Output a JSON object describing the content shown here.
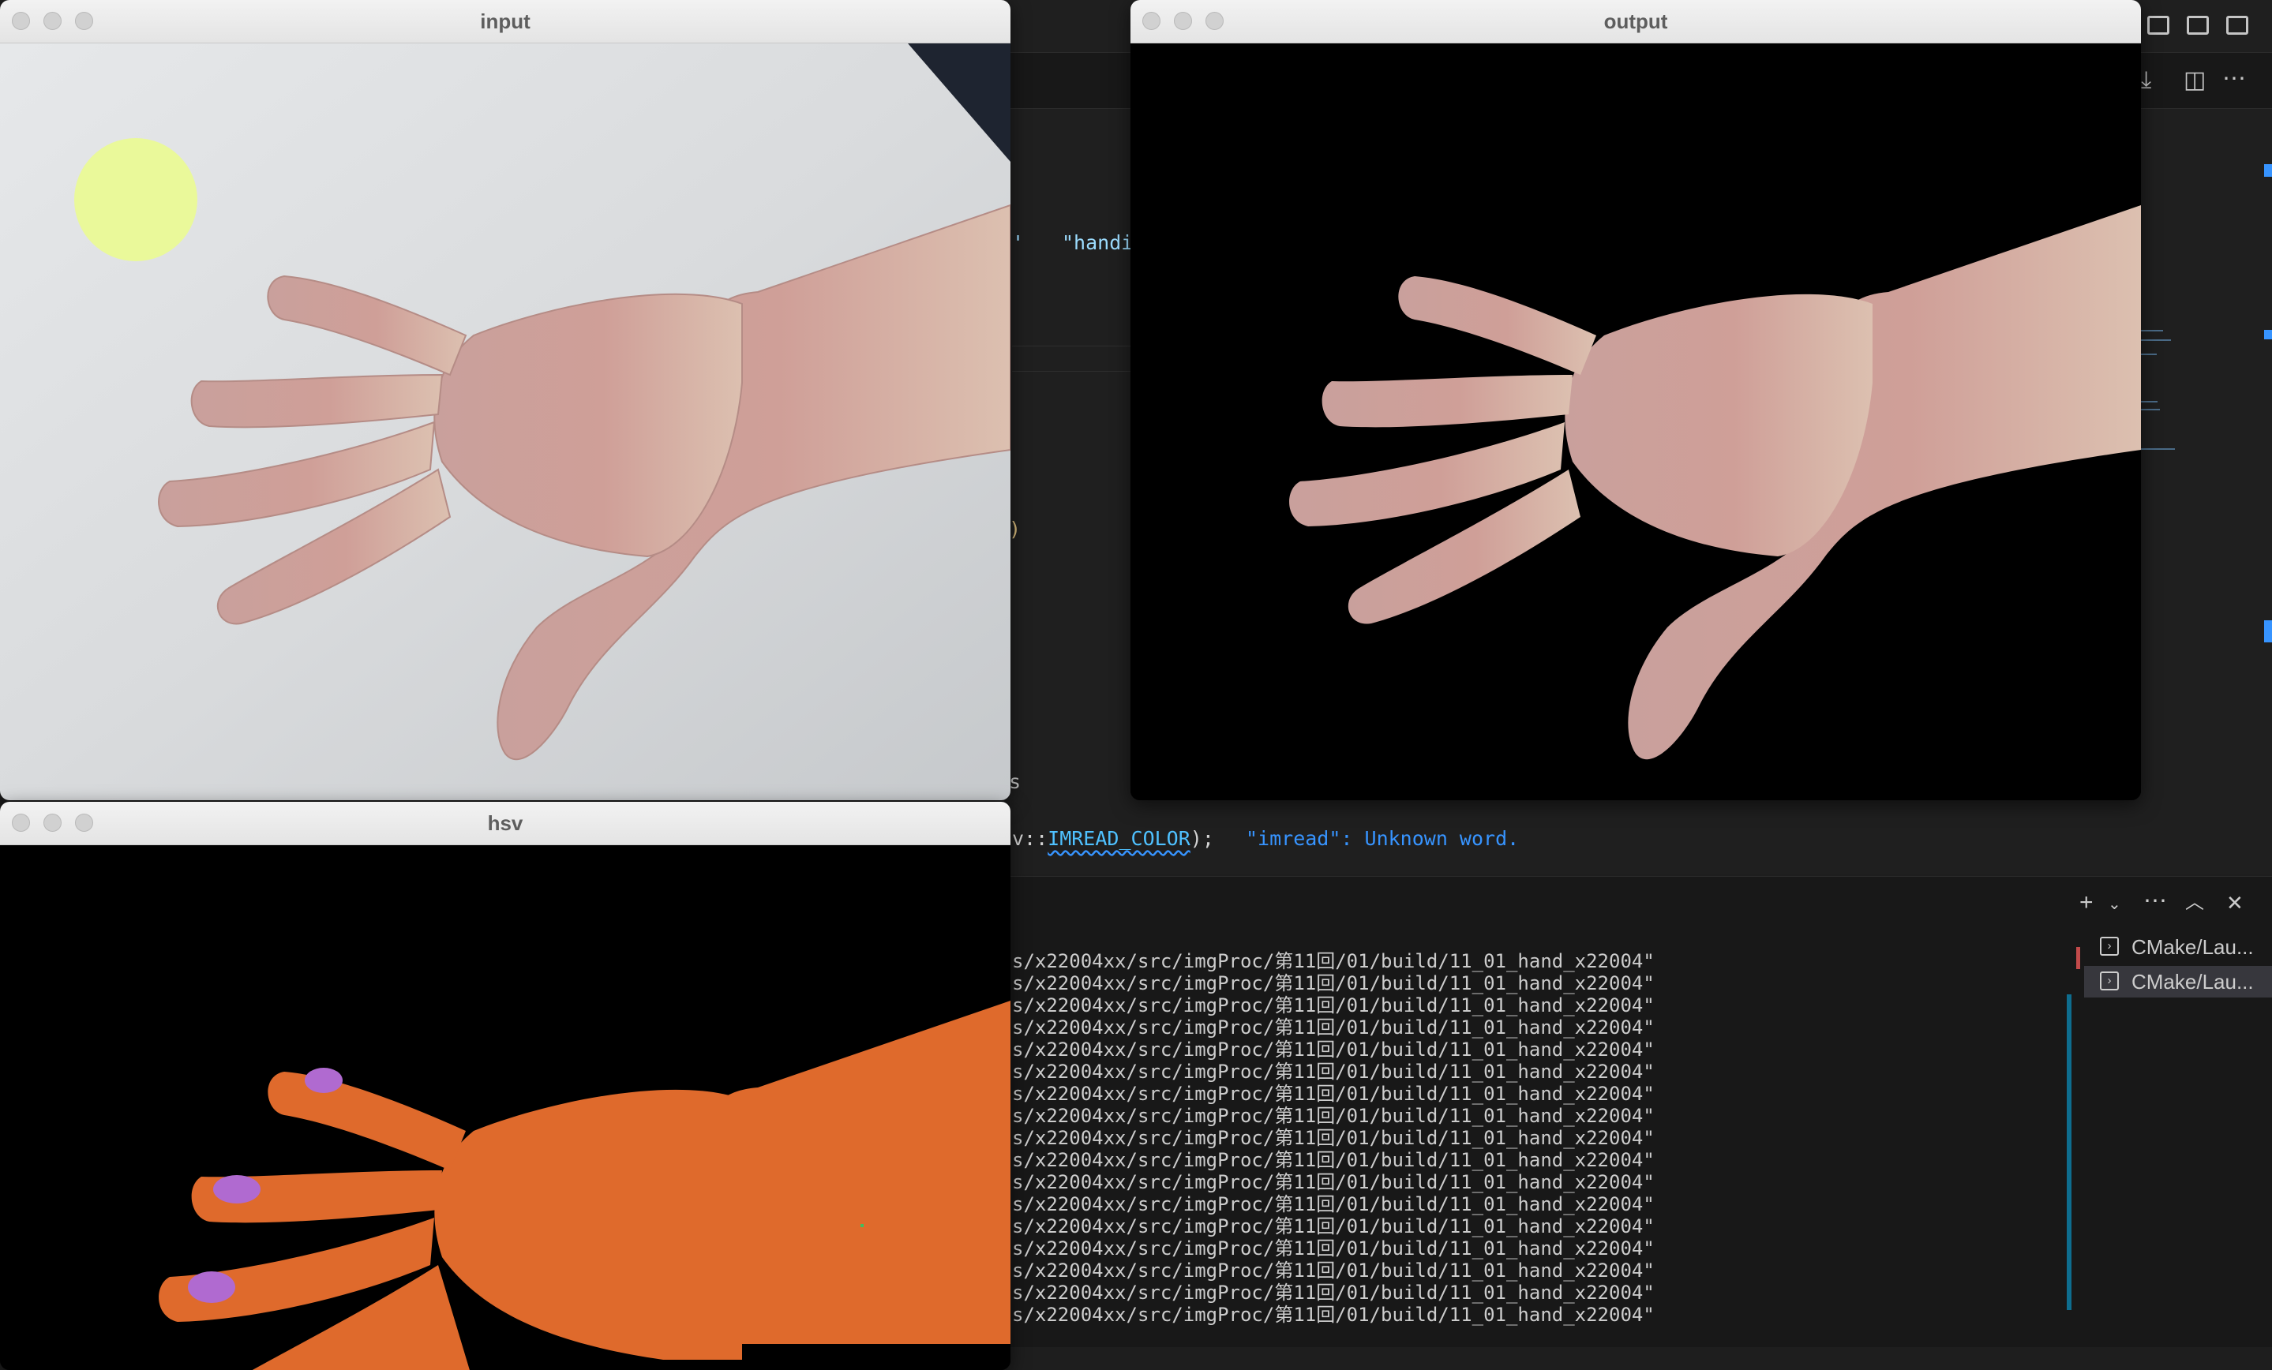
{
  "windows": {
    "input": {
      "title": "input"
    },
    "output": {
      "title": "output"
    },
    "hsv": {
      "title": "hsv"
    }
  },
  "editor": {
    "string_fragment": "\"handi",
    "code_prefix": "v::",
    "code_enum": "IMREAD_COLOR",
    "code_suffix": ");",
    "diagnostic": "\"imread\": Unknown word."
  },
  "terminal": {
    "lines": [
      "s/x22004xx/src/imgProc/第11回/01/build/11_01_hand_x22004\"",
      "s/x22004xx/src/imgProc/第11回/01/build/11_01_hand_x22004\"",
      "s/x22004xx/src/imgProc/第11回/01/build/11_01_hand_x22004\"",
      "s/x22004xx/src/imgProc/第11回/01/build/11_01_hand_x22004\"",
      "s/x22004xx/src/imgProc/第11回/01/build/11_01_hand_x22004\"",
      "s/x22004xx/src/imgProc/第11回/01/build/11_01_hand_x22004\"",
      "s/x22004xx/src/imgProc/第11回/01/build/11_01_hand_x22004\"",
      "s/x22004xx/src/imgProc/第11回/01/build/11_01_hand_x22004\"",
      "s/x22004xx/src/imgProc/第11回/01/build/11_01_hand_x22004\"",
      "s/x22004xx/src/imgProc/第11回/01/build/11_01_hand_x22004\"",
      "s/x22004xx/src/imgProc/第11回/01/build/11_01_hand_x22004\"",
      "s/x22004xx/src/imgProc/第11回/01/build/11_01_hand_x22004\"",
      "s/x22004xx/src/imgProc/第11回/01/build/11_01_hand_x22004\"",
      "s/x22004xx/src/imgProc/第11回/01/build/11_01_hand_x22004\"",
      "s/x22004xx/src/imgProc/第11回/01/build/11_01_hand_x22004\"",
      "s/x22004xx/src/imgProc/第11回/01/build/11_01_hand_x22004\"",
      "s/x22004xx/src/imgProc/第11回/01/build/11_01_hand_x22004\""
    ],
    "tabs": [
      {
        "label": "CMake/Lau..."
      },
      {
        "label": "CMake/Lau..."
      }
    ]
  },
  "icons": {
    "add": "plus-icon",
    "more": "ellipsis-icon",
    "maximize": "chevron-up-icon",
    "close": "close-icon",
    "layout": "layout-icon",
    "split": "split-editor-icon"
  },
  "colors": {
    "editor_bg": "#1e1e1e",
    "panel_bg": "#181818",
    "string": "#9cdcfe",
    "accent": "#3794ff",
    "window_title_bg": "#e8e8e8",
    "skin_hsv": "#e0692a"
  }
}
